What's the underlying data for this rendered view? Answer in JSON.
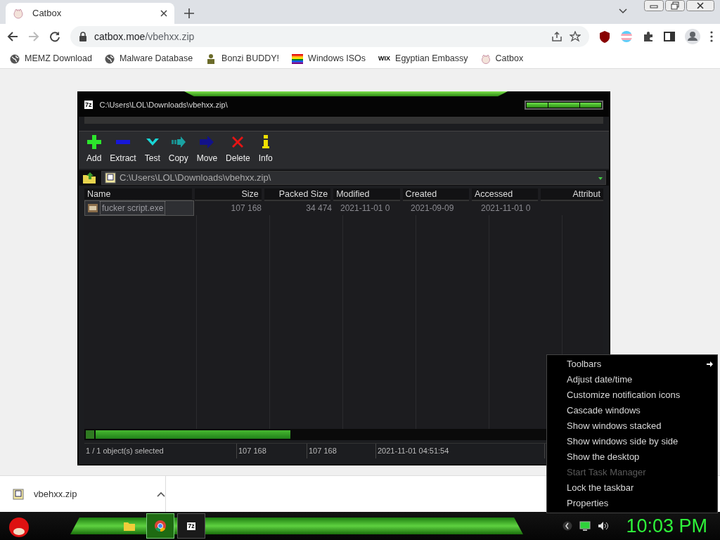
{
  "browser": {
    "tab": {
      "title": "Catbox",
      "selected": true
    },
    "address": {
      "host": "catbox.moe",
      "path": "/vbehxx.zip"
    },
    "bookmarks": [
      {
        "label": "MEMZ Download",
        "kind": "globe"
      },
      {
        "label": "Malware Database",
        "kind": "globe"
      },
      {
        "label": "Bonzi BUDDY!",
        "kind": "figure"
      },
      {
        "label": "Windows ISOs",
        "kind": "rainbow"
      },
      {
        "label": "Egyptian Embassy",
        "kind": "wordmark",
        "icon_text": "WIX"
      },
      {
        "label": "Catbox",
        "kind": "cat"
      }
    ]
  },
  "archiver": {
    "logo": "7z",
    "title": "C:\\Users\\LOL\\Downloads\\vbehxx.zip\\",
    "toolbar": [
      {
        "label": "Add",
        "kind": "add"
      },
      {
        "label": "Extract",
        "kind": "extract"
      },
      {
        "label": "Test",
        "kind": "test"
      },
      {
        "label": "Copy",
        "kind": "copy"
      },
      {
        "label": "Move",
        "kind": "move"
      },
      {
        "label": "Delete",
        "kind": "delete"
      },
      {
        "label": "Info",
        "kind": "info"
      }
    ],
    "path": "C:\\Users\\LOL\\Downloads\\vbehxx.zip\\",
    "columns": [
      "Name",
      "Size",
      "Packed Size",
      "Modified",
      "Created",
      "Accessed",
      "Attribut"
    ],
    "rows": [
      {
        "selected": true,
        "cells": [
          "fucker script.exe",
          "107 168",
          "34 474",
          "2021-11-01 0",
          "2021-09-09",
          "2021-11-01 0"
        ]
      }
    ],
    "status": [
      "1 / 1 object(s) selected",
      "107 168",
      "107 168",
      "2021-11-01 04:51:54"
    ]
  },
  "downloads": [
    {
      "filename": "vbehxx.zip"
    }
  ],
  "context_menu": [
    {
      "label": "Toolbars",
      "submenu": true,
      "disabled": false
    },
    {
      "label": "Adjust date/time",
      "submenu": false,
      "disabled": false
    },
    {
      "label": "Customize notification icons",
      "submenu": false,
      "disabled": false
    },
    {
      "label": "Cascade windows",
      "submenu": false,
      "disabled": false
    },
    {
      "label": "Show windows stacked",
      "submenu": false,
      "disabled": false
    },
    {
      "label": "Show windows side by side",
      "submenu": false,
      "disabled": false
    },
    {
      "label": "Show the desktop",
      "submenu": false,
      "disabled": false
    },
    {
      "label": "Start Task Manager",
      "submenu": false,
      "disabled": true
    },
    {
      "label": "Lock the taskbar",
      "submenu": false,
      "disabled": false
    },
    {
      "label": "Properties",
      "submenu": false,
      "disabled": false
    }
  ],
  "taskbar": {
    "apps": [
      {
        "kind": "folder",
        "selected": false
      },
      {
        "kind": "chrome",
        "selected": true
      },
      {
        "kind": "archive",
        "selected": false,
        "icon_text": "7z"
      }
    ],
    "clock": "10:03 PM"
  }
}
